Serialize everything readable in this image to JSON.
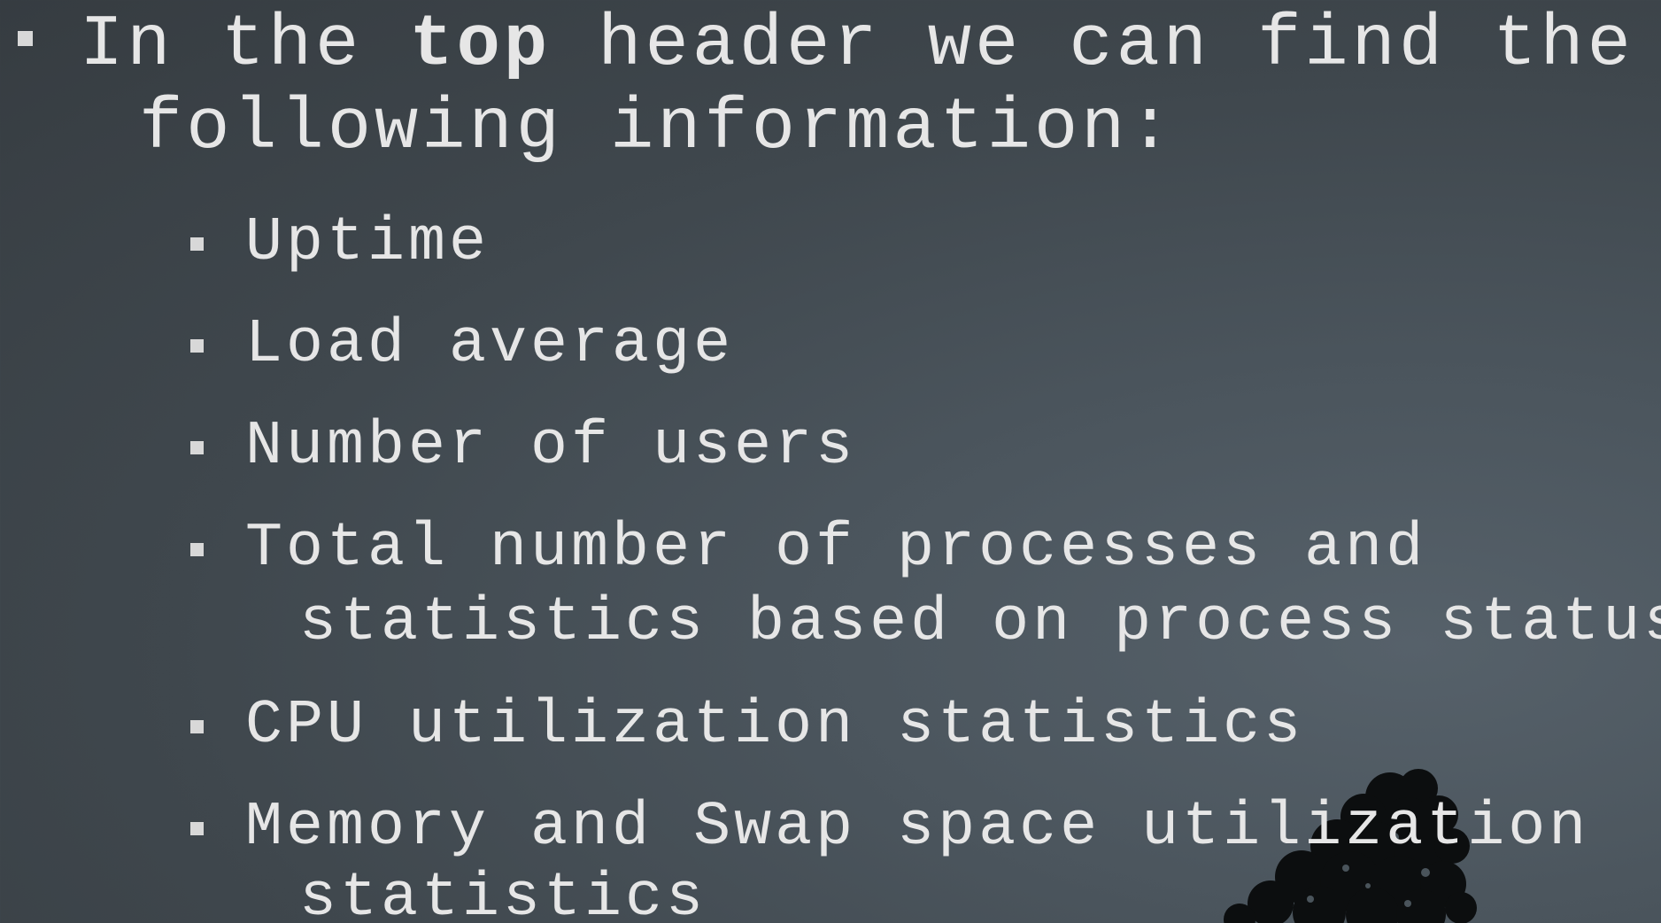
{
  "main_bullet": {
    "line1_prefix": "In the ",
    "line1_bold": "top",
    "line1_suffix": " header we can find the",
    "line2": "following information:"
  },
  "sub_bullets": [
    {
      "lines": [
        "Uptime"
      ]
    },
    {
      "lines": [
        "Load average"
      ]
    },
    {
      "lines": [
        "Number of users"
      ]
    },
    {
      "lines": [
        "Total number of processes and",
        "statistics based on process status"
      ]
    },
    {
      "lines": [
        "CPU utilization statistics"
      ]
    },
    {
      "lines": [
        "Memory and Swap space utilization",
        "statistics"
      ]
    }
  ],
  "icons": {
    "bullet": "square-bullet-icon",
    "decoration": "tree-silhouette-icon"
  },
  "colors": {
    "background": "#3f474d",
    "text": "#e6e6e6"
  }
}
